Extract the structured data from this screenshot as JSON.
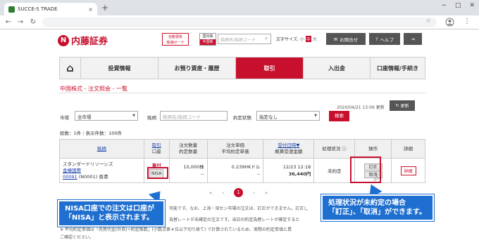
{
  "browser": {
    "tab_title": "SUCCE-S TRADE",
    "new_tab": "+",
    "close": "×",
    "win_min": "−",
    "win_max": "□",
    "win_close": "✕"
  },
  "header": {
    "logo_mark": "N",
    "logo_text": "内藤証券",
    "auto_update_line1": "自動更新",
    "auto_update_line2": "株価ボード",
    "market_line1": "国内株",
    "market_line2": "中国株",
    "search_placeholder": "銘柄名/銘柄コード",
    "font_size_label": "文字サイズ:",
    "font_small": "小",
    "font_mid": "中",
    "font_large": "大",
    "contact_label": "お問合せ",
    "help_label": "ヘルプ"
  },
  "nav": {
    "items": [
      "投資情報",
      "お預り資産・履歴",
      "取引",
      "入出金",
      "口座情報/手続き"
    ]
  },
  "page": {
    "breadcrumb": "中国株式 - 注文照会 - 一覧",
    "updated": "2020/04/21 13:06 更新",
    "refresh_label": "更新"
  },
  "filters": {
    "market_label": "市場",
    "market_value": "全市場",
    "stock_label": "銘柄",
    "stock_placeholder": "銘柄名/銘柄コード",
    "status_label": "約定状態",
    "status_value": "指定なし",
    "search_label": "検索",
    "total": "総数：1件｜表示件数：100件"
  },
  "table": {
    "headers": {
      "stock": "銘柄",
      "type_l1": "取引",
      "type_l2": "口座",
      "qty_l1": "注文数量",
      "qty_l2": "約定数量",
      "price_l1": "注文単価",
      "price_l2": "平均約定単価",
      "date_l1": "受付日時▼",
      "date_l2": "概算受渡金額",
      "status": "処理状況",
      "ops": "操作",
      "detail": "詳細"
    },
    "row": {
      "company_en": "スタンダードリソーシズ",
      "company_jp": "金棟国際",
      "code": "00091",
      "subcode": "(N0001)",
      "market": "香港",
      "trade": "買付",
      "account": "NISA",
      "qty": "10,000株",
      "qty_done": "--",
      "price": "0.239HKドル",
      "avg_price": "--",
      "date": "12/23 12:18",
      "amount": "36,440円",
      "status": "未約定",
      "correct": "訂正",
      "cancel": "取消",
      "detail": "詳細"
    }
  },
  "pager": {
    "first": "«",
    "prev": "‹",
    "current": "1",
    "next": "›",
    "last": "»"
  },
  "notes": {
    "line1": "可能です。なお、上海・深セン市場の注文は、訂正ができません。訂正し",
    "line2": "為替レートが未確定の注文です。当日の約定為替レートが確定すると",
    "line3": "※ 平均約定単価は「売買代金(外貨)÷約定株数」(小数点第４位以下切り捨て) で計算されているため、実際の約定単価と異",
    "line4": "ご確認ください。"
  },
  "annotations": {
    "left_line1": "NISA口座での注文は口座が",
    "left_line2": "「NISA」と表示されます。",
    "right_line1": "処理状況が未約定の場合",
    "right_line2": "「訂正」、「取消」ができます。"
  },
  "colors": {
    "brand": "#c8102e",
    "callout": "#1e6fd0"
  }
}
